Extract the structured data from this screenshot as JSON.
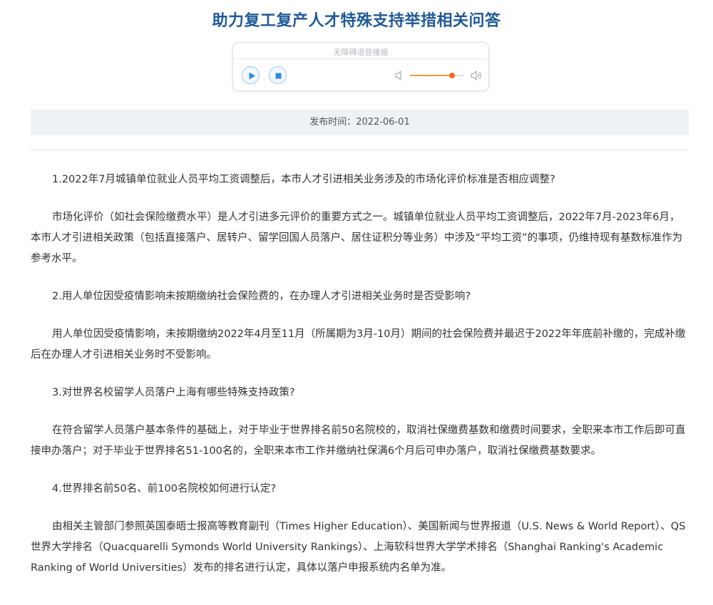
{
  "page": {
    "title": "助力复工复产人才特殊支持举措相关问答"
  },
  "player": {
    "label": "无障碍语音播报",
    "volume_level": 0.78,
    "accent_color": "#ef6b22"
  },
  "meta": {
    "publish_time": "发布时间：2022-06-01"
  },
  "article": {
    "paragraphs": [
      "1.2022年7月城镇单位就业人员平均工资调整后，本市人才引进相关业务涉及的市场化评价标准是否相应调整?",
      "市场化评价（如社会保险缴费水平）是人才引进多元评价的重要方式之一。城镇单位就业人员平均工资调整后，2022年7月-2023年6月，本市人才引进相关政策（包括直接落户、居转户、留学回国人员落户、居住证积分等业务）中涉及“平均工资”的事项，仍维持现有基数标准作为参考水平。",
      "2.用人单位因受疫情影响未按期缴纳社会保险费的，在办理人才引进相关业务时是否受影响?",
      "用人单位因受疫情影响，未按期缴纳2022年4月至11月（所属期为3月-10月）期间的社会保险费并最迟于2022年年底前补缴的，完成补缴后在办理人才引进相关业务时不受影响。",
      "3.对世界名校留学人员落户上海有哪些特殊支持政策?",
      "在符合留学人员落户基本条件的基础上，对于毕业于世界排名前50名院校的，取消社保缴费基数和缴费时间要求，全职来本市工作后即可直接申办落户；对于毕业于世界排名51-100名的，全职来本市工作并缴纳社保满6个月后可申办落户，取消社保缴费基数要求。",
      "4.世界排名前50名、前100名院校如何进行认定?",
      "由相关主管部门参照英国泰晤士报高等教育副刊（Times Higher Education）、美国新闻与世界报道（U.S. News & World Report）、QS世界大学排名（Quacquarelli Symonds World University Rankings）、上海软科世界大学学术排名（Shanghai Ranking's Academic Ranking of World Universities）发布的排名进行认定，具体以落户申报系统内名单为准。"
    ]
  }
}
